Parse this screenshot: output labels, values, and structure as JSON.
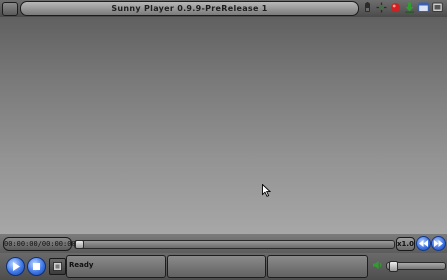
{
  "window": {
    "title": "Sunny Player 0.9.9-PreRelease 1"
  },
  "titlebar_icons": [
    {
      "name": "battery-icon",
      "color": "#2b2b2b"
    },
    {
      "name": "network-icon",
      "color": "#4a6a4a"
    },
    {
      "name": "record-icon",
      "color": "#d02020"
    },
    {
      "name": "download-icon",
      "color": "#2e9e2e"
    },
    {
      "name": "window-icon",
      "color": "#3a5fae"
    },
    {
      "name": "fullscreen-icon",
      "color": "#3a3a3a"
    }
  ],
  "seek": {
    "time_display": "00:00:00/00:00:00",
    "seek_position": 0,
    "speed": "x1.0"
  },
  "controls": {
    "status": "Ready",
    "volume_level": 0.05
  },
  "colors": {
    "accent_blue": "#3f78e8",
    "record_red": "#d02020",
    "download_green": "#2e9e2e"
  }
}
